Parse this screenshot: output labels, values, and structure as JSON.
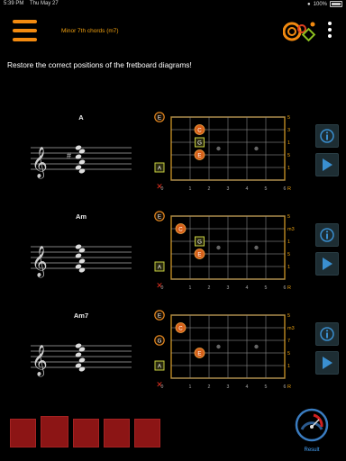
{
  "status": {
    "time": "5:39 PM",
    "date": "Thu May 27",
    "battery": "100%"
  },
  "header": {
    "title": "Minor 7th chords (m7)",
    "menu_icon": "hamburger-menu-icon",
    "more_icon": "kebab-menu-icon"
  },
  "instruction": "Restore the correct positions of the fretboard diagrams!",
  "chords": [
    {
      "name": "A",
      "accidental": "#",
      "open_markers": [
        "E",
        "A"
      ],
      "fingers": [
        {
          "label": "C",
          "string": 2,
          "fret": 2,
          "shape": "circle"
        },
        {
          "label": "G",
          "string": 3,
          "fret": 2,
          "shape": "square"
        },
        {
          "label": "E",
          "string": 4,
          "fret": 2,
          "shape": "circle"
        }
      ],
      "right_labels": [
        "5",
        "3",
        "1",
        "5",
        "1",
        "R"
      ]
    },
    {
      "name": "Am",
      "accidental": "",
      "open_markers": [
        "E",
        "A"
      ],
      "fingers": [
        {
          "label": "C",
          "string": 2,
          "fret": 1,
          "shape": "circle"
        },
        {
          "label": "G",
          "string": 3,
          "fret": 2,
          "shape": "square"
        },
        {
          "label": "E",
          "string": 4,
          "fret": 2,
          "shape": "circle"
        }
      ],
      "right_labels": [
        "5",
        "m3",
        "1",
        "5",
        "1",
        "R"
      ]
    },
    {
      "name": "Am7",
      "accidental": "",
      "open_markers": [
        "E",
        "G",
        "A"
      ],
      "fingers": [
        {
          "label": "C",
          "string": 2,
          "fret": 1,
          "shape": "circle"
        },
        {
          "label": "E",
          "string": 4,
          "fret": 2,
          "shape": "circle"
        }
      ],
      "right_labels": [
        "5",
        "m3",
        "7",
        "5",
        "1",
        "R"
      ]
    }
  ],
  "fret_numbers": [
    "0",
    "1",
    "2",
    "3",
    "4",
    "5",
    "6"
  ],
  "mute_symbol": "✕",
  "side_buttons": {
    "info_icon": "info-icon",
    "play_icon": "play-icon"
  },
  "answer_slot_count": 5,
  "result": {
    "label": "Result",
    "icon": "gauge-icon"
  },
  "colors": {
    "accent": "#f28a10",
    "fret_label": "#e8a010",
    "answer": "#8c1515",
    "play": "#3a8fd0",
    "result": "#4aa8ff"
  }
}
